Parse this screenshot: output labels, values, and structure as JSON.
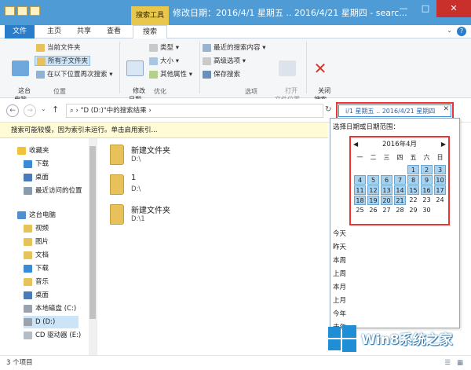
{
  "window": {
    "title": "修改日期：2016/4/1 星期五 .. 2016/4/21 星期四 - searc...",
    "context_tab": "搜索工具",
    "min": "—",
    "max": "□",
    "close": "✕"
  },
  "ribbon_tabs": {
    "file": "文件",
    "home": "主页",
    "share": "共享",
    "view": "查看",
    "search": "搜索",
    "help": "?"
  },
  "ribbon": {
    "location": {
      "this_pc": "这台\n电脑",
      "current_folder": "当前文件夹",
      "all_subfolders": "所有子文件夹",
      "search_again": "在以下位置再次搜索",
      "label": "位置"
    },
    "refine": {
      "date_modified": "修改\n日期",
      "kind": "类型",
      "size": "大小",
      "other_props": "其他属性",
      "label": "优化"
    },
    "options": {
      "recent_searches": "最近的搜索内容",
      "advanced": "高级选项",
      "save_search": "保存搜索",
      "open_location": "打开\n文件位置",
      "label": "选项"
    },
    "close": {
      "label": "关闭\n搜索"
    }
  },
  "address": {
    "path": "\"D (D:)\"中的搜索结果",
    "search_value": "i/1 星期五 .. 2016/4/21 星期四"
  },
  "infobar": "搜索可能较慢，因为索引未运行。单击启用索引...",
  "nav": {
    "favorites": "收藏夹",
    "downloads": "下载",
    "desktop": "桌面",
    "recent": "最近访问的位置",
    "this_pc": "这台电脑",
    "videos": "视频",
    "pictures": "图片",
    "documents": "文档",
    "downloads2": "下载",
    "music": "音乐",
    "desktop2": "桌面",
    "local_c": "本地磁盘 (C:)",
    "drive_d": "D (D:)",
    "cd_e": "CD 驱动器 (E:)"
  },
  "results": [
    {
      "name": "新建文件夹",
      "path": "D:\\"
    },
    {
      "name": "1",
      "path": "D:\\"
    },
    {
      "name": "新建文件夹",
      "path": "D:\\1"
    }
  ],
  "picker": {
    "hint": "选择日期或日期范围：",
    "month": "2016年4月",
    "prev": "◀",
    "next": "▶",
    "weekdays": [
      "一",
      "二",
      "三",
      "四",
      "五",
      "六",
      "日"
    ],
    "weeks": [
      [
        "",
        "",
        "",
        "",
        "1",
        "2",
        "3"
      ],
      [
        "4",
        "5",
        "6",
        "7",
        "8",
        "9",
        "10"
      ],
      [
        "11",
        "12",
        "13",
        "14",
        "15",
        "16",
        "17"
      ],
      [
        "18",
        "19",
        "20",
        "21",
        "22",
        "23",
        "24"
      ],
      [
        "25",
        "26",
        "27",
        "28",
        "29",
        "30",
        ""
      ]
    ],
    "selected_range": [
      1,
      21
    ],
    "quick": [
      "今天",
      "昨天",
      "本周",
      "上周",
      "本月",
      "上月",
      "今年",
      "去年"
    ]
  },
  "status": "3 个项目",
  "watermark": "Win8系统之家",
  "colors": {
    "accent": "#2a7dca",
    "highlight": "#e33333",
    "selected": "#a9d2ef"
  }
}
